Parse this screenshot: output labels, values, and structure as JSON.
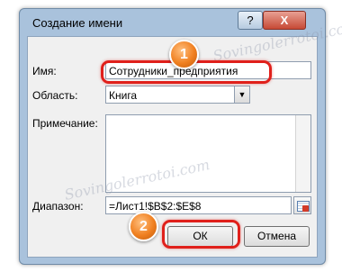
{
  "dialog": {
    "title": "Создание имени",
    "help_label": "?",
    "close_label": "X"
  },
  "name": {
    "label": "Имя:",
    "value": "Сотрудники_предприятия"
  },
  "scope": {
    "label": "Область:",
    "value": "Книга",
    "arrow": "▼"
  },
  "comment": {
    "label": "Примечание:",
    "value": ""
  },
  "range": {
    "label": "Диапазон:",
    "value": "=Лист1!$B$2:$E$8"
  },
  "buttons": {
    "ok": "ОК",
    "cancel": "Отмена"
  },
  "markers": {
    "first": "1",
    "second": "2"
  },
  "watermark": "Sovingolerrotoi.com",
  "colors": {
    "highlight": "#e0201b",
    "marker": "#f08020"
  }
}
